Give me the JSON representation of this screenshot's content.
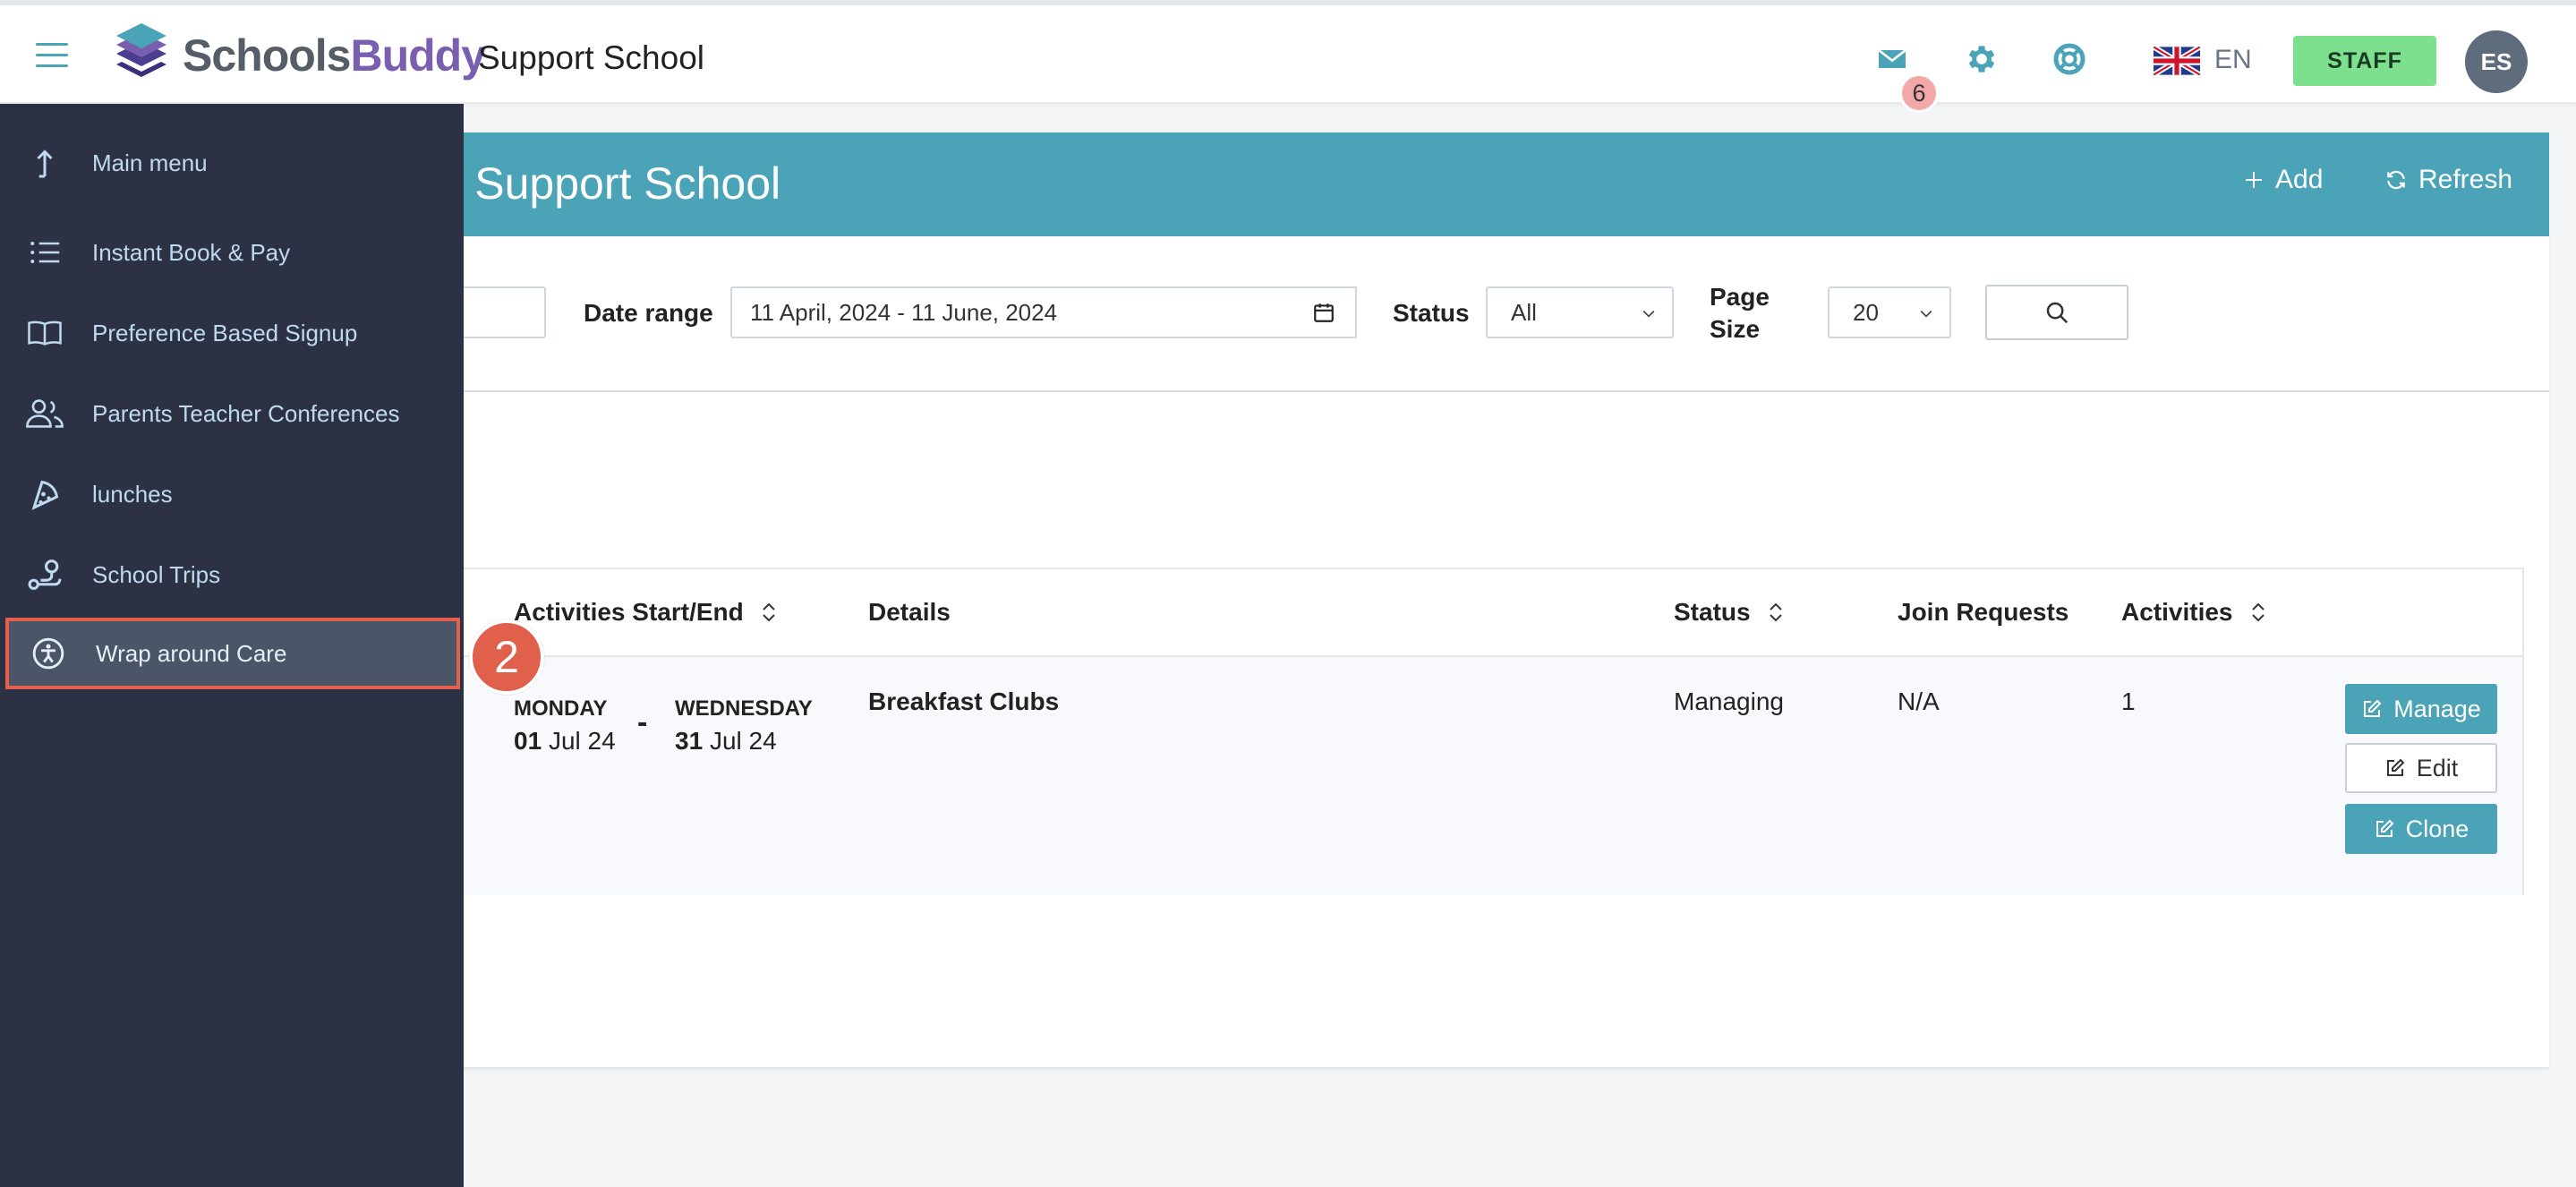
{
  "header": {
    "logo_part1": "Schools",
    "logo_part2": "Buddy",
    "school_name": "Support School",
    "mail_count": "6",
    "language": "EN",
    "role_button": "STAFF",
    "avatar_initials": "ES"
  },
  "panel": {
    "title": "e - Support School",
    "add_label": "Add",
    "refresh_label": "Refresh"
  },
  "filters": {
    "date_range_label": "Date range",
    "date_range_value": "11 April, 2024 - 11 June, 2024",
    "status_label": "Status",
    "status_value": "All",
    "page_size_label_line1": "Page",
    "page_size_label_line2": "Size",
    "page_size_value": "20"
  },
  "table": {
    "columns": [
      "Activities Start/End",
      "Details",
      "Status",
      "Join Requests",
      "Activities"
    ],
    "rows": [
      {
        "start_day": "MONDAY",
        "start_num": "01",
        "start_rest": "Jul 24",
        "separator": "-",
        "end_day": "WEDNESDAY",
        "end_num": "31",
        "end_rest": "Jul 24",
        "details": "Breakfast Clubs",
        "status": "Managing",
        "join_requests": "N/A",
        "activities": "1",
        "actions": [
          "Manage",
          "Edit",
          "Clone"
        ]
      }
    ]
  },
  "sidemenu": {
    "items": [
      {
        "label": "Main menu",
        "icon": "arrow-up-icon"
      },
      {
        "label": "Instant Book & Pay",
        "icon": "list-icon"
      },
      {
        "label": "Preference Based Signup",
        "icon": "book-icon"
      },
      {
        "label": "Parents Teacher Conferences",
        "icon": "people-icon"
      },
      {
        "label": "lunches",
        "icon": "pizza-icon"
      },
      {
        "label": "School Trips",
        "icon": "route-icon"
      },
      {
        "label": "Wrap around Care",
        "icon": "accessibility-icon"
      }
    ],
    "active_index": 6,
    "step_number": "2"
  },
  "colors": {
    "accent": "#4aa3b6",
    "sidebar": "#2c3243",
    "highlight": "#e4604c",
    "staff": "#7de08e"
  }
}
